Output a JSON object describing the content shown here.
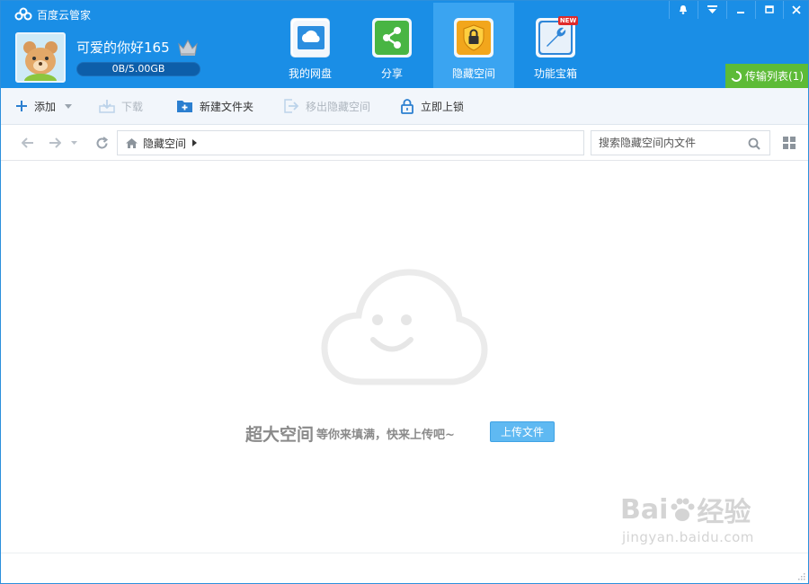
{
  "app": {
    "title": "百度云管家"
  },
  "user": {
    "name": "可爱的你好165",
    "quota": "0B/5.00GB"
  },
  "nav": {
    "items": [
      {
        "label": "我的网盘"
      },
      {
        "label": "分享"
      },
      {
        "label": "隐藏空间"
      },
      {
        "label": "功能宝箱",
        "badge": "NEW"
      }
    ],
    "active": "隐藏空间"
  },
  "transfer": {
    "label": "传输列表(1)"
  },
  "toolbar": {
    "add": "添加",
    "download": "下载",
    "new_folder": "新建文件夹",
    "move_out": "移出隐藏空间",
    "lock": "立即上锁"
  },
  "breadcrumb": {
    "current": "隐藏空间"
  },
  "search": {
    "placeholder": "搜索隐藏空间内文件"
  },
  "empty_state": {
    "headline": "超大空间",
    "subline": "等你来填满，快来上传吧~",
    "upload_label": "上传文件"
  },
  "watermark": {
    "brand": "Bai",
    "brand_suffix": "经验",
    "url": "jingyan.baidu.com"
  },
  "colors": {
    "header": "#1a8ee6",
    "active_tab": "#3aa4f1",
    "transfer": "#5dbb37",
    "upload": "#5fb9f2"
  },
  "icons": {
    "app": "cloud-logo-icon",
    "crown": "crown-icon",
    "drive": "cloud-drive-icon",
    "share": "share-icon",
    "hidden": "shield-lock-icon",
    "tools": "wrench-icon"
  }
}
